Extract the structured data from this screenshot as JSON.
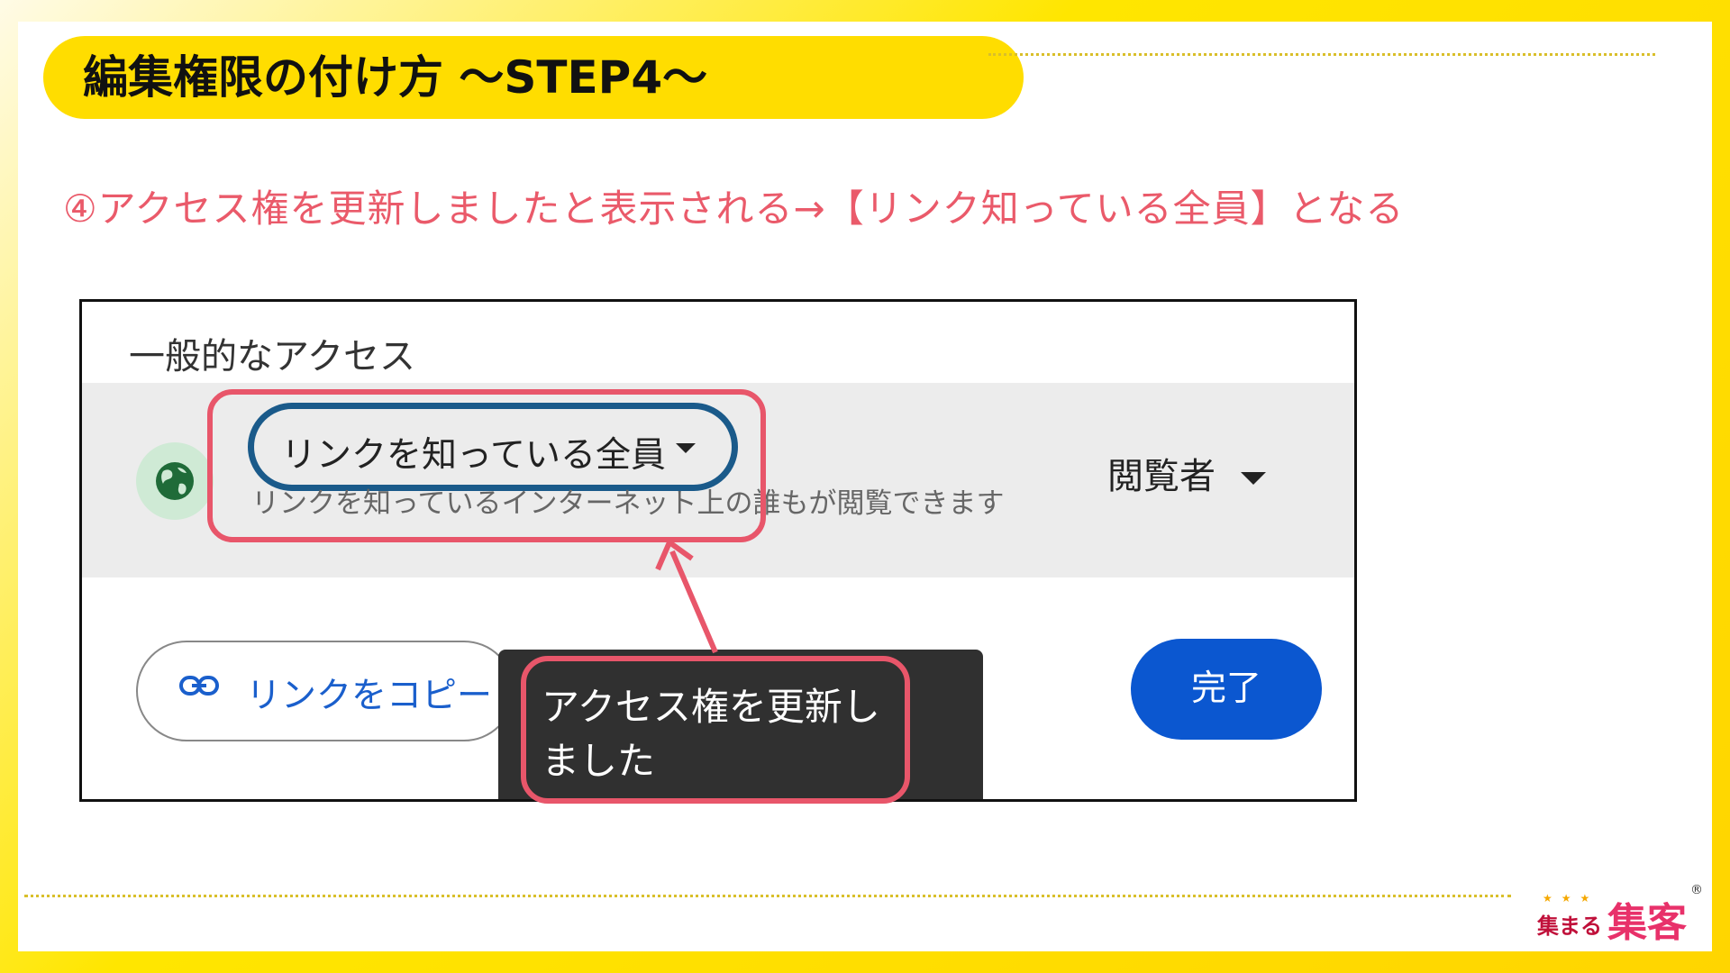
{
  "slide": {
    "title": "編集権限の付け方 〜STEP4〜",
    "instruction": "④アクセス権を更新しましたと表示される→【リンク知っている全員】となる"
  },
  "general_access": {
    "heading": "一般的なアクセス",
    "scope_label": "リンクを知っている全員",
    "scope_description": "リンクを知っているインターネット上の誰もが閲覧できます",
    "role_label": "閲覧者",
    "icons": [
      "globe-icon",
      "caret-down-icon",
      "link-icon"
    ]
  },
  "buttons": {
    "copy_link": "リンクをコピー",
    "done": "完了"
  },
  "toast": {
    "message": "アクセス権を更新しました"
  },
  "logo": {
    "small": "集まる",
    "big": "集客",
    "stars": "★★★",
    "registered": "®"
  },
  "colors": {
    "accent_yellow": "#ffdd00",
    "callout_red": "#e8566a",
    "scope_outline": "#1a5a8a",
    "done_button": "#0b57d0",
    "link_blue": "#1a5fcc",
    "toast_bg": "#303030"
  }
}
